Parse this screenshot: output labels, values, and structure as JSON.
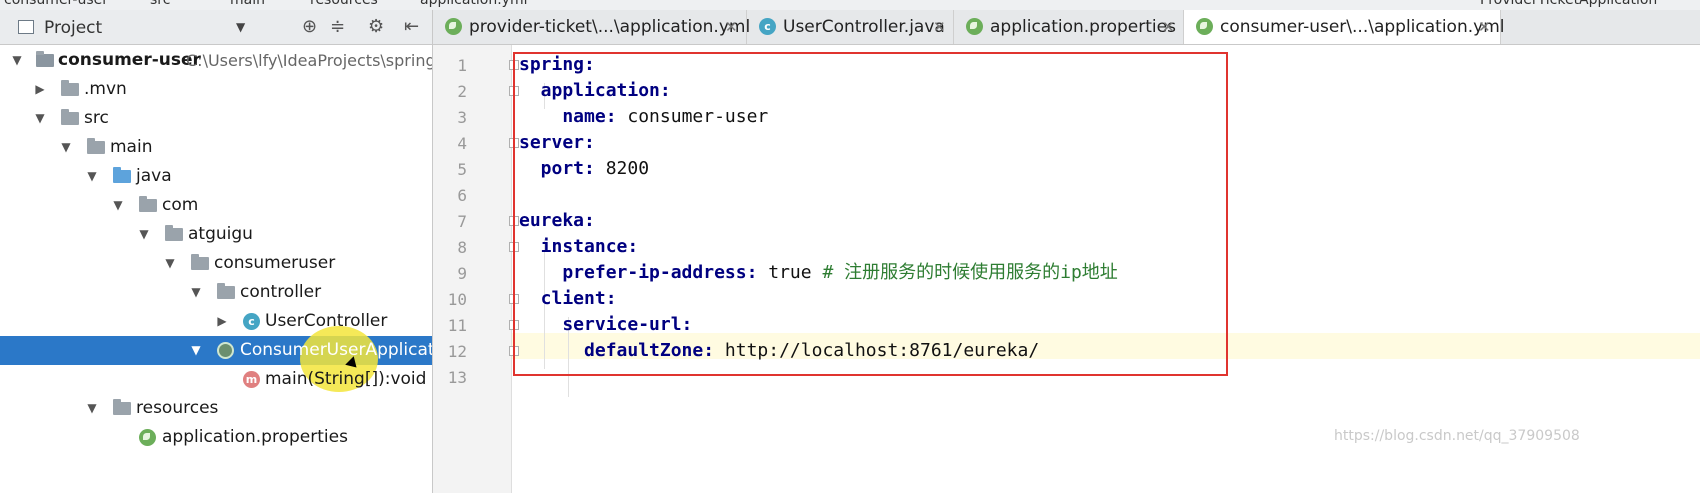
{
  "breadcrumb": {
    "items": [
      "consumer-user",
      "src",
      "main",
      "resources",
      "application.yml",
      "ProviderTicketApplication"
    ]
  },
  "project_panel": {
    "title": "Project",
    "tree": [
      {
        "label": "consumer-user",
        "path": "C:\\Users\\lfy\\IdeaProjects\\springb",
        "expanded": true
      },
      {
        "label": ".mvn",
        "expanded": false
      },
      {
        "label": "src",
        "expanded": true
      },
      {
        "label": "main",
        "expanded": true
      },
      {
        "label": "java",
        "expanded": true
      },
      {
        "label": "com",
        "expanded": true
      },
      {
        "label": "atguigu",
        "expanded": true
      },
      {
        "label": "consumeruser",
        "expanded": true
      },
      {
        "label": "controller",
        "expanded": true
      },
      {
        "label": "UserController",
        "expanded": false
      },
      {
        "label": "ConsumerUserApplication",
        "expanded": true,
        "selected": true
      },
      {
        "label": "main(String[]):void"
      },
      {
        "label": "resources",
        "expanded": true
      },
      {
        "label": "application.properties"
      }
    ]
  },
  "tabs": [
    {
      "label": "provider-ticket\\...\\application.yml"
    },
    {
      "label": "UserController.java"
    },
    {
      "label": "application.properties"
    },
    {
      "label": "consumer-user\\...\\application.yml",
      "active": true
    }
  ],
  "editor": {
    "line_numbers": [
      "1",
      "2",
      "3",
      "4",
      "5",
      "6",
      "7",
      "8",
      "9",
      "10",
      "11",
      "12",
      "13"
    ],
    "lines": [
      {
        "key": "spring:",
        "value": ""
      },
      {
        "key": "  application:",
        "value": ""
      },
      {
        "key": "    name:",
        "value": " consumer-user"
      },
      {
        "key": "server:",
        "value": ""
      },
      {
        "key": "  port:",
        "value": " 8200"
      },
      {
        "key": "",
        "value": ""
      },
      {
        "key": "eureka:",
        "value": ""
      },
      {
        "key": "  instance:",
        "value": ""
      },
      {
        "key": "    prefer-ip-address:",
        "value": " true",
        "comment": " # 注册服务的时候使用服务的ip地址"
      },
      {
        "key": "  client:",
        "value": ""
      },
      {
        "key": "    service-url:",
        "value": ""
      },
      {
        "key": "      defaultZone:",
        "value": " http://localhost:8761/eureka/"
      },
      {
        "key": "",
        "value": ""
      }
    ]
  },
  "watermark": "https://blog.csdn.net/qq_37909508",
  "colors": {
    "selection": "#2b78c8",
    "yaml_key": "#000080",
    "comment": "#2e7d32",
    "annotation_box": "#e0342f"
  }
}
